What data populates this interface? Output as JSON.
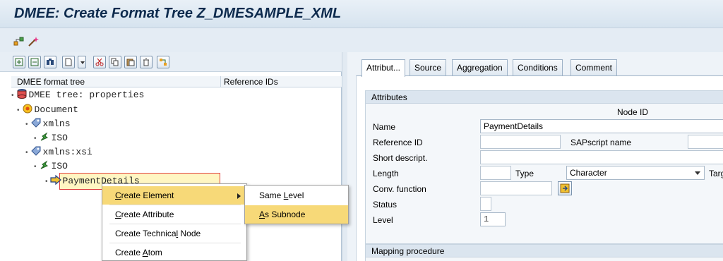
{
  "window": {
    "title": "DMEE: Create Format Tree Z_DMESAMPLE_XML"
  },
  "app_toolbar": {
    "icons": [
      "tree-check-icon",
      "magic-wand-icon"
    ]
  },
  "left_toolbar": {
    "icons": [
      "expand-subtree-icon",
      "collapse-subtree-icon",
      "find-icon",
      "new-node-icon",
      "dropdown-icon",
      "cut-icon",
      "copy-icon",
      "paste-icon",
      "delete-icon",
      "transfer-icon"
    ]
  },
  "tree": {
    "columns": [
      "DMEE format tree",
      "Reference IDs"
    ],
    "nodes": [
      {
        "label": "DMEE tree: properties",
        "icon": "database-icon"
      },
      {
        "label": "Document",
        "icon": "document-node-icon"
      },
      {
        "label": "xmlns",
        "icon": "attribute-tag-icon"
      },
      {
        "label": "ISO",
        "icon": "atom-icon"
      },
      {
        "label": "xmlns:xsi",
        "icon": "attribute-tag-icon"
      },
      {
        "label": "ISO",
        "icon": "atom-icon"
      },
      {
        "label": "PaymentDetails",
        "icon": "element-arrow-icon"
      }
    ]
  },
  "context_menu": {
    "items": [
      {
        "pre": "",
        "u": "C",
        "post": "reate Element",
        "has_submenu": true,
        "highlighted": true
      },
      {
        "pre": "",
        "u": "C",
        "post": "reate Attribute"
      },
      {
        "pre": "Create Technica",
        "u": "l",
        "post": " Node"
      },
      {
        "pre": "Create ",
        "u": "A",
        "post": "tom"
      }
    ],
    "submenu": [
      {
        "pre": "Same ",
        "u": "L",
        "post": "evel"
      },
      {
        "pre": "",
        "u": "A",
        "post": "s Subnode",
        "highlighted": true
      }
    ]
  },
  "tabs": [
    "Attribut...",
    "Source",
    "Aggregation",
    "Conditions",
    "Comment"
  ],
  "active_tab": "Attribut...",
  "attributes": {
    "group_title": "Attributes",
    "node_id_header": "Node ID",
    "name_label": "Name",
    "name_value": "PaymentDetails",
    "reference_id_label": "Reference ID",
    "sapscript_name_label": "SAPscript name",
    "short_descript_label": "Short descript.",
    "length_label": "Length",
    "type_label": "Type",
    "type_value": "Character",
    "target_label": "Targe",
    "conv_function_label": "Conv. function",
    "status_label": "Status",
    "level_label": "Level",
    "level_value": "1"
  },
  "mapping": {
    "group_title": "Mapping procedure"
  }
}
